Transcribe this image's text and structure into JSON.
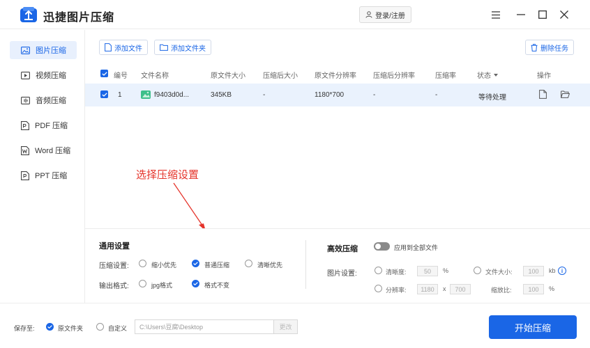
{
  "app": {
    "title": "迅捷图片压缩",
    "login_label": "登录/注册"
  },
  "sidebar": {
    "items": [
      {
        "label": "图片压缩",
        "icon": "image-icon",
        "active": true
      },
      {
        "label": "视频压缩",
        "icon": "video-icon",
        "active": false
      },
      {
        "label": "音频压缩",
        "icon": "audio-icon",
        "active": false
      },
      {
        "label": "PDF 压缩",
        "icon": "pdf-icon",
        "active": false
      },
      {
        "label": "Word 压缩",
        "icon": "word-icon",
        "active": false
      },
      {
        "label": "PPT 压缩",
        "icon": "ppt-icon",
        "active": false
      }
    ]
  },
  "toolbar": {
    "add_file": "添加文件",
    "add_folder": "添加文件夹",
    "delete_task": "删除任务"
  },
  "table": {
    "headers": {
      "index": "编号",
      "name": "文件名称",
      "orig_size": "原文件大小",
      "comp_size": "压缩后大小",
      "orig_res": "原文件分辨率",
      "comp_res": "压缩后分辨率",
      "ratio": "压缩率",
      "status": "状态",
      "actions": "操作"
    },
    "rows": [
      {
        "index": "1",
        "name": "f9403d0d...",
        "orig_size": "345KB",
        "comp_size": "-",
        "orig_res": "1180*700",
        "comp_res": "-",
        "ratio": "-",
        "status": "等待处理"
      }
    ]
  },
  "annotation": "选择压缩设置",
  "settings": {
    "general_title": "通用设置",
    "compress_label": "压缩设置:",
    "compress_options": [
      "缩小优先",
      "普通压缩",
      "清晰优先"
    ],
    "compress_selected": "普通压缩",
    "format_label": "输出格式:",
    "format_options": [
      "jpg格式",
      "格式不变"
    ],
    "format_selected": "格式不变",
    "efficient_title": "高效压缩",
    "apply_all": "应用到全部文件",
    "image_settings_label": "图片设置:",
    "clarity_label": "清晰度:",
    "clarity_value": "50",
    "clarity_unit": "%",
    "filesize_label": "文件大小:",
    "filesize_value": "100",
    "filesize_unit": "kb",
    "resolution_label": "分辨率:",
    "res_width": "1180",
    "res_sep": "x",
    "res_height": "700",
    "scale_label": "缩放比:",
    "scale_value": "100",
    "scale_unit": "%"
  },
  "footer": {
    "save_to_label": "保存至:",
    "original_folder": "原文件夹",
    "custom": "自定义",
    "path": "C:\\Users\\豆腐\\Desktop",
    "change": "更改",
    "start_button": "开始压缩"
  },
  "colors": {
    "accent": "#1a66e6",
    "annotation": "#e5332a",
    "row_highlight": "#eaf2fd"
  }
}
